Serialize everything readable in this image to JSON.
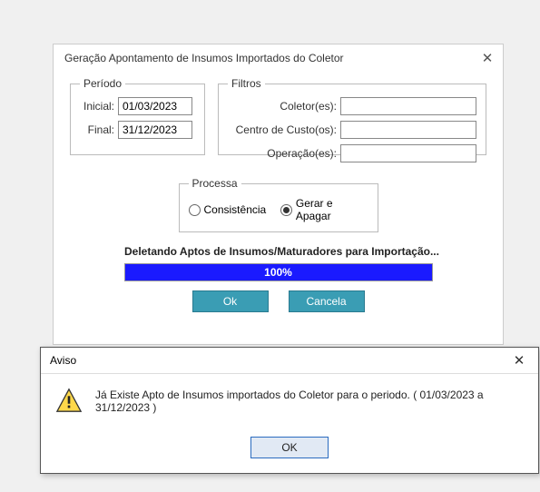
{
  "main": {
    "title": "Geração Apontamento de Insumos Importados do Coletor",
    "periodo": {
      "legend": "Período",
      "inicial_label": "Inicial:",
      "inicial_value": "01/03/2023",
      "final_label": "Final:",
      "final_value": "31/12/2023"
    },
    "filtros": {
      "legend": "Filtros",
      "coletores_label": "Coletor(es):",
      "coletores_value": "",
      "ccusto_label": "Centro de Custo(os):",
      "ccusto_value": "",
      "operacao_label": "Operação(es):",
      "operacao_value": ""
    },
    "processa": {
      "legend": "Processa",
      "opt_consistencia": "Consistência",
      "opt_gerar": "Gerar e Apagar",
      "selected": "gerar"
    },
    "status_text": "Deletando Aptos de Insumos/Maturadores para Importação...",
    "progress_pct": "100%",
    "ok_label": "Ok",
    "cancel_label": "Cancela"
  },
  "aviso": {
    "title": "Aviso",
    "message": "Já Existe Apto de Insumos importados do Coletor para o periodo. ( 01/03/2023 a 31/12/2023 )",
    "ok_label": "OK"
  }
}
